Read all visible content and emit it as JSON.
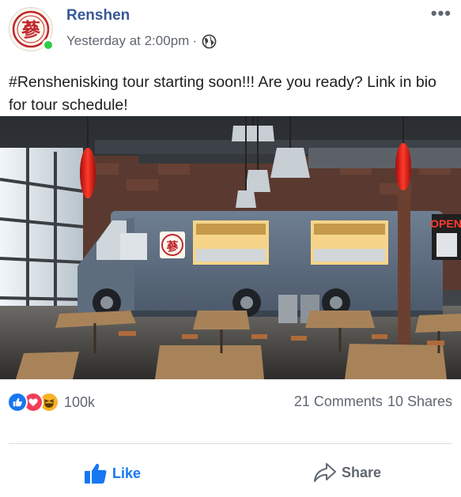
{
  "post": {
    "author": "Renshen",
    "avatar_glyph": "蔘",
    "timestamp": "Yesterday at 2:00pm",
    "separator": "·",
    "privacy_icon": "globe-icon",
    "more_icon": "more-options-icon",
    "more_label": "•••",
    "text": "#Renshenisking tour starting soon!!! Are you ready? Link in bio for tour schedule!",
    "photo": {
      "truck_logo_glyph": "蔘",
      "open_sign": "OPEN"
    }
  },
  "stats": {
    "reaction_icons": [
      "like-reaction-icon",
      "love-reaction-icon",
      "haha-reaction-icon"
    ],
    "reaction_count": "100k",
    "comments": "21 Comments",
    "shares": "10 Shares"
  },
  "actions": {
    "like_label": "Like",
    "share_label": "Share"
  },
  "colors": {
    "name": "#385898",
    "like": "#1877f2",
    "online": "#31cc46",
    "brand_red": "#c0282d"
  }
}
